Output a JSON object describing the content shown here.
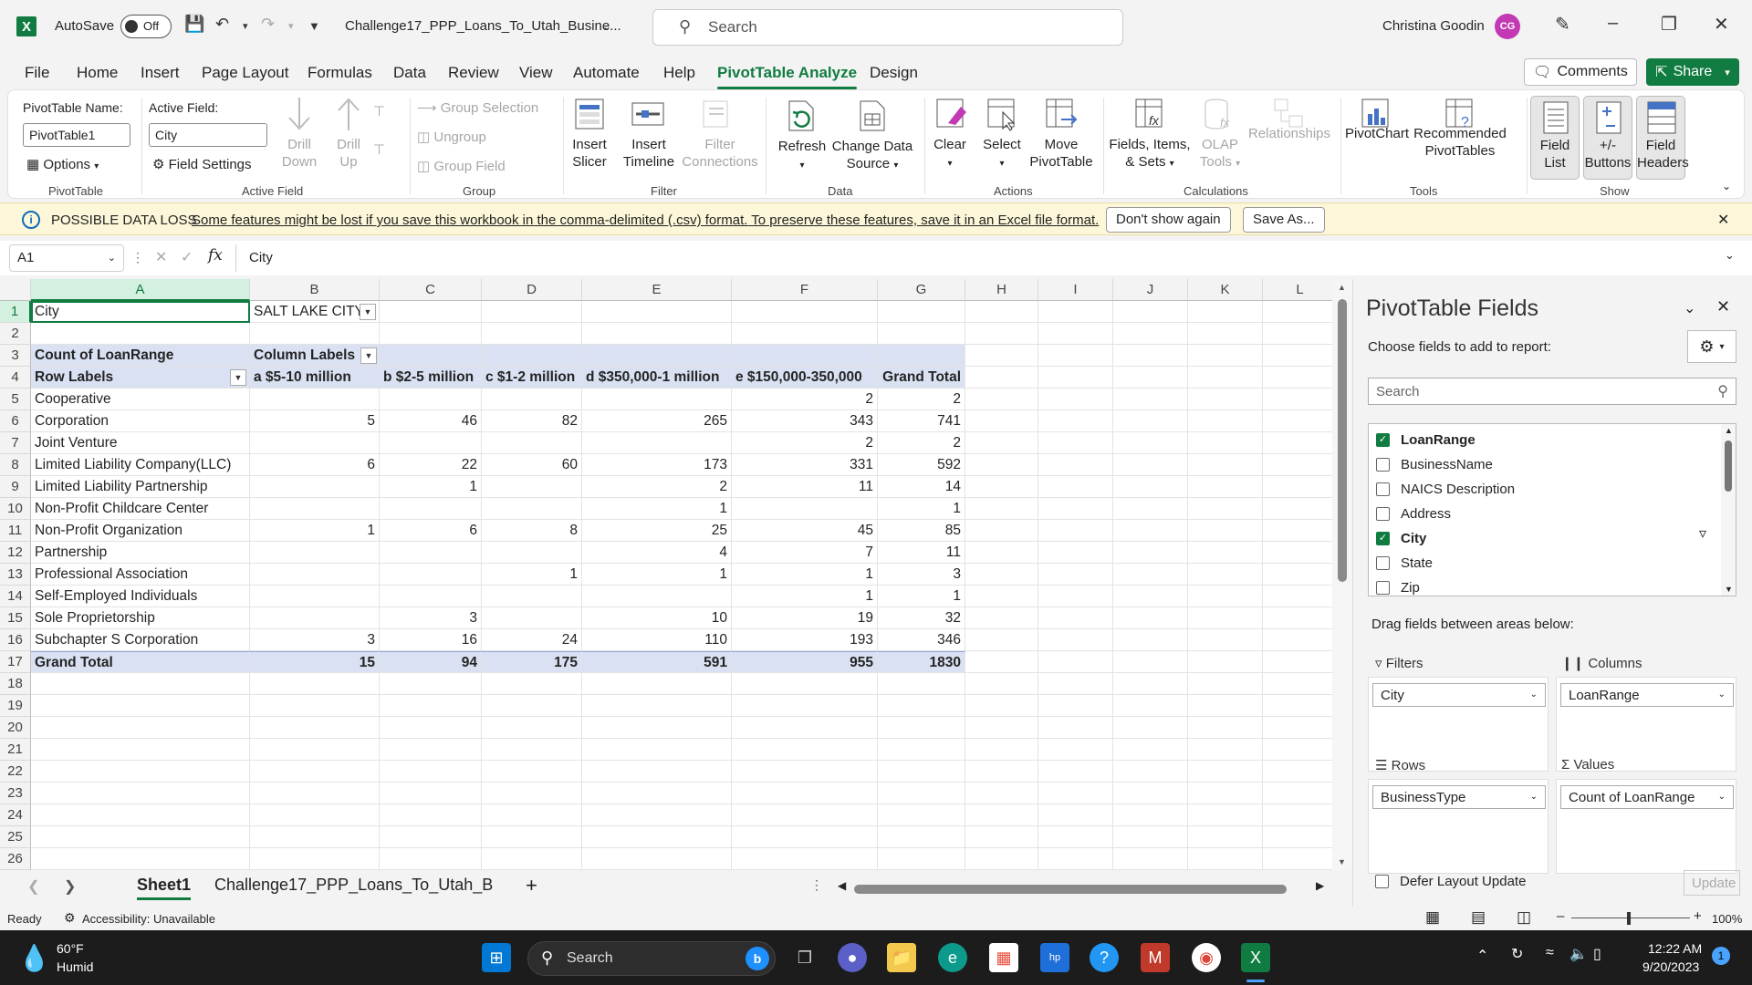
{
  "titlebar": {
    "autosave_label": "AutoSave",
    "autosave_state": "Off",
    "doc_title": "Challenge17_PPP_Loans_To_Utah_Busine...",
    "search_placeholder": "Search",
    "user_name": "Christina Goodin",
    "user_initials": "CG"
  },
  "tabs": [
    "File",
    "Home",
    "Insert",
    "Page Layout",
    "Formulas",
    "Data",
    "Review",
    "View",
    "Automate",
    "Help",
    "PivotTable Analyze",
    "Design"
  ],
  "tabs_active": "PivotTable Analyze",
  "buttons": {
    "comments": "Comments",
    "share": "Share"
  },
  "ribbon": {
    "pivot_name_label": "PivotTable Name:",
    "pivot_name_value": "PivotTable1",
    "options": "Options",
    "active_field_label": "Active Field:",
    "active_field_value": "City",
    "field_settings": "Field Settings",
    "drill_down": "Drill Down",
    "drill_up": "Drill Up",
    "group_selection": "Group Selection",
    "ungroup": "Ungroup",
    "group_field": "Group Field",
    "insert_slicer": "Insert Slicer",
    "insert_timeline": "Insert Timeline",
    "filter_connections": "Filter Connections",
    "refresh": "Refresh",
    "change_data_source": "Change Data Source",
    "clear": "Clear",
    "select": "Select",
    "move_pivottable": "Move PivotTable",
    "fields_items_sets": "Fields, Items, & Sets",
    "olap_tools": "OLAP Tools",
    "relationships": "Relationships",
    "pivotchart": "PivotChart",
    "recommended_pivottables": "Recommended PivotTables",
    "field_list": "Field List",
    "plus_minus_buttons": "+/- Buttons",
    "field_headers": "Field Headers",
    "groups": [
      "PivotTable",
      "Active Field",
      "Group",
      "Filter",
      "Data",
      "Actions",
      "Calculations",
      "Tools",
      "Show"
    ]
  },
  "message_bar": {
    "title": "POSSIBLE DATA LOSS",
    "text": "Some features might be lost if you save this workbook in the comma-delimited (.csv) format. To preserve these features, save it in an Excel file format.",
    "dont_show": "Don't show again",
    "save_as": "Save As..."
  },
  "formula_bar": {
    "name_box": "A1",
    "content": "City"
  },
  "columns": [
    "A",
    "B",
    "C",
    "D",
    "E",
    "F",
    "G",
    "H",
    "I",
    "J",
    "K",
    "L"
  ],
  "rows": [
    "1",
    "2",
    "3",
    "4",
    "5",
    "6",
    "7",
    "8",
    "9",
    "10",
    "11",
    "12",
    "13",
    "14",
    "15",
    "16",
    "17",
    "18",
    "19",
    "20",
    "21",
    "22",
    "23",
    "24",
    "25",
    "26"
  ],
  "pivot": {
    "filter_label": "City",
    "filter_value": "SALT LAKE CITY",
    "count_label": "Count of LoanRange",
    "column_labels": "Column Labels",
    "row_labels": "Row Labels",
    "headers": [
      "a $5-10 million",
      "b $2-5 million",
      "c $1-2 million",
      "d $350,000-1 million",
      "e $150,000-350,000",
      "Grand Total"
    ],
    "data": [
      {
        "label": "Cooperative",
        "values": [
          "",
          "",
          "",
          "",
          "2",
          "2"
        ]
      },
      {
        "label": "Corporation",
        "values": [
          "5",
          "46",
          "82",
          "265",
          "343",
          "741"
        ]
      },
      {
        "label": "Joint Venture",
        "values": [
          "",
          "",
          "",
          "",
          "2",
          "2"
        ]
      },
      {
        "label": "Limited  Liability Company(LLC)",
        "values": [
          "6",
          "22",
          "60",
          "173",
          "331",
          "592"
        ]
      },
      {
        "label": "Limited Liability Partnership",
        "values": [
          "",
          "1",
          "",
          "2",
          "11",
          "14"
        ]
      },
      {
        "label": "Non-Profit Childcare Center",
        "values": [
          "",
          "",
          "",
          "1",
          "",
          "1"
        ]
      },
      {
        "label": "Non-Profit Organization",
        "values": [
          "1",
          "6",
          "8",
          "25",
          "45",
          "85"
        ]
      },
      {
        "label": "Partnership",
        "values": [
          "",
          "",
          "",
          "4",
          "7",
          "11"
        ]
      },
      {
        "label": "Professional Association",
        "values": [
          "",
          "",
          "1",
          "1",
          "1",
          "3"
        ]
      },
      {
        "label": "Self-Employed Individuals",
        "values": [
          "",
          "",
          "",
          "",
          "1",
          "1"
        ]
      },
      {
        "label": "Sole Proprietorship",
        "values": [
          "",
          "3",
          "",
          "10",
          "19",
          "32"
        ]
      },
      {
        "label": "Subchapter S Corporation",
        "values": [
          "3",
          "16",
          "24",
          "110",
          "193",
          "346"
        ]
      }
    ],
    "total_label": "Grand Total",
    "totals": [
      "15",
      "94",
      "175",
      "591",
      "955",
      "1830"
    ]
  },
  "sheets": {
    "active": "Sheet1",
    "other": "Challenge17_PPP_Loans_To_Utah_B"
  },
  "status": {
    "ready": "Ready",
    "accessibility": "Accessibility: Unavailable",
    "zoom": "100%"
  },
  "pane": {
    "title": "PivotTable Fields",
    "subtitle": "Choose fields to add to report:",
    "search_placeholder": "Search",
    "fields": [
      {
        "name": "LoanRange",
        "checked": true
      },
      {
        "name": "BusinessName",
        "checked": false
      },
      {
        "name": "NAICS Description",
        "checked": false
      },
      {
        "name": "Address",
        "checked": false
      },
      {
        "name": "City",
        "checked": true
      },
      {
        "name": "State",
        "checked": false
      },
      {
        "name": "Zip",
        "checked": false
      }
    ],
    "drag_text": "Drag fields between areas below:",
    "filters_title": "Filters",
    "filters_value": "City",
    "columns_title": "Columns",
    "columns_value": "LoanRange",
    "rows_title": "Rows",
    "rows_value": "BusinessType",
    "values_title": "Values",
    "values_value": "Count of LoanRange",
    "defer": "Defer Layout Update",
    "update": "Update"
  },
  "taskbar": {
    "temp": "60°F",
    "weather": "Humid",
    "search": "Search",
    "time": "12:22 AM",
    "date": "9/20/2023",
    "notif": "1"
  }
}
